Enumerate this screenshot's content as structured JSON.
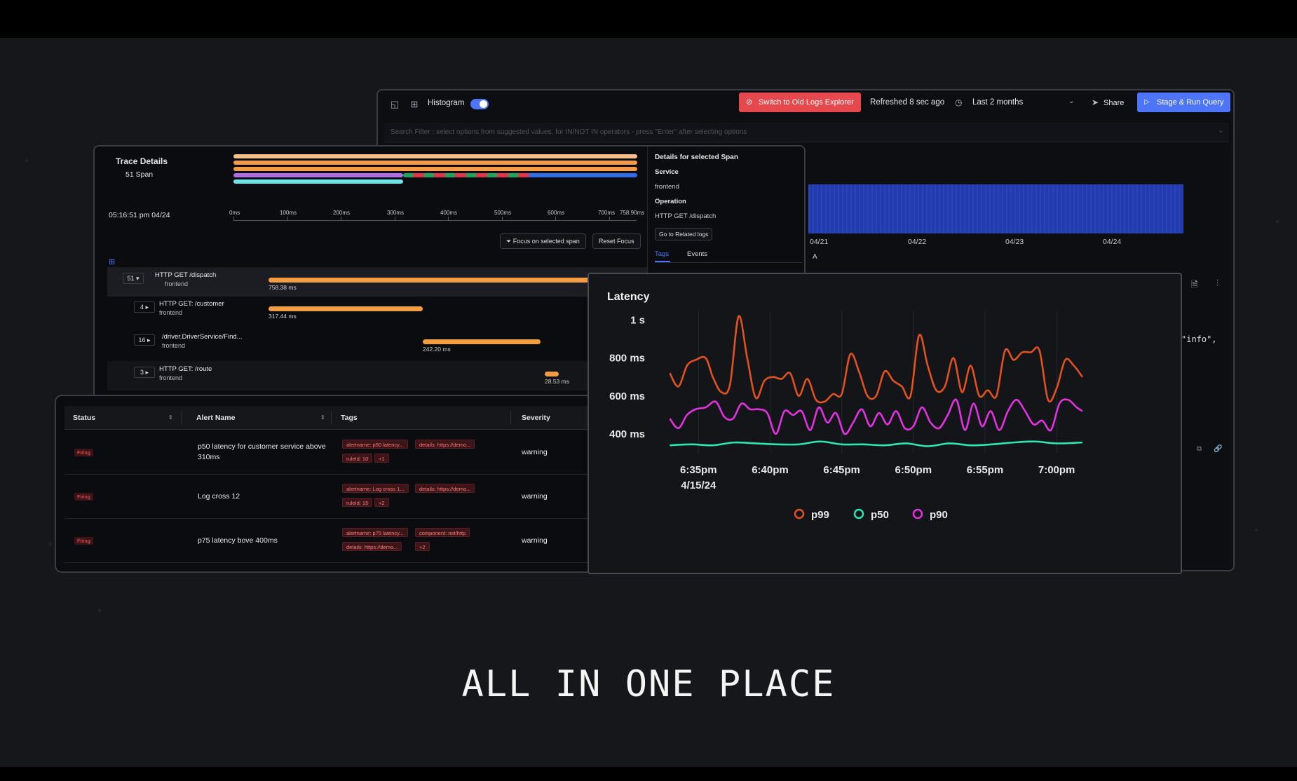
{
  "logs_explorer": {
    "histogram_label": "Histogram",
    "histogram_enabled": true,
    "switch_button": "Switch to Old Logs Explorer",
    "refreshed": "Refreshed 8 sec ago",
    "time_range": "Last 2 months",
    "share": "Share",
    "run_query": "Stage & Run Query",
    "search_placeholder": "Search Filter : select options from suggested values, for IN/NOT IN operators - press \"Enter\" after selecting options",
    "x_ticks": [
      "04/21",
      "04/22",
      "04/23",
      "04/24"
    ],
    "legend_a": "A",
    "snippet_text": "\"info\","
  },
  "trace_details": {
    "title": "Trace Details",
    "span_count": "51 Span",
    "timestamp": "05:16:51 pm 04/24",
    "ticks": [
      "0ms",
      "100ms",
      "200ms",
      "300ms",
      "400ms",
      "500ms",
      "600ms",
      "700ms",
      "758.90ms"
    ],
    "focus_button": "Focus on selected span",
    "reset_button": "Reset Focus",
    "rows": [
      {
        "count": "51",
        "operation": "HTTP GET /dispatch",
        "service": "frontend",
        "duration": "758.38 ms"
      },
      {
        "count": "4",
        "operation": "HTTP GET: /customer",
        "service": "frontend",
        "duration": "317.44 ms"
      },
      {
        "count": "16",
        "operation": "/driver.DriverService/Find...",
        "service": "frontend",
        "duration": "242.20 ms"
      },
      {
        "count": "3",
        "operation": "HTTP GET: /route",
        "service": "frontend",
        "duration": "28.53 ms"
      }
    ],
    "details": {
      "heading": "Details for selected Span",
      "service_label": "Service",
      "service_value": "frontend",
      "operation_label": "Operation",
      "operation_value": "HTTP GET /dispatch",
      "related_logs_button": "Go to Related logs",
      "tab_tags": "Tags",
      "tab_events": "Events"
    }
  },
  "alerts": {
    "columns": [
      "Status",
      "Alert Name",
      "Tags",
      "Severity"
    ],
    "rows": [
      {
        "status": "Firing",
        "name": "p50 latency for customer service above 310ms",
        "tags": [
          "alertname: p50 latency...",
          "details: https://demo...",
          "ruleId: 10",
          "+1"
        ],
        "severity": "warning"
      },
      {
        "status": "Firing",
        "name": "Log cross 12",
        "tags": [
          "alertname: Log cross 1...",
          "details: https://demo...",
          "ruleId: 15",
          "+2"
        ],
        "severity": "warning"
      },
      {
        "status": "Firing",
        "name": "p75 latency bove 400ms",
        "tags": [
          "alertname: p75 latency...",
          "component: net/http",
          "details: https://demo...",
          "+2"
        ],
        "severity": "warning"
      }
    ]
  },
  "chart_data": {
    "type": "line",
    "title": "Latency",
    "y_ticks": [
      "1 s",
      "800 ms",
      "600 ms",
      "400 ms"
    ],
    "y_tick_values": [
      1000,
      800,
      600,
      400
    ],
    "x_ticks": [
      "6:35pm",
      "6:40pm",
      "6:45pm",
      "6:50pm",
      "6:55pm",
      "7:00pm"
    ],
    "x_tick_values": [
      2,
      7,
      12,
      17,
      22,
      27
    ],
    "x_date_label": "4/15/24",
    "ylim": [
      300,
      1050
    ],
    "xlim": [
      -1,
      29
    ],
    "legend_position": "bottom",
    "series": [
      {
        "name": "p99",
        "color": "#e0521f",
        "x": [
          0,
          0.6,
          1.2,
          1.8,
          2.5,
          3,
          3.6,
          4.2,
          4.8,
          5.4,
          6,
          6.6,
          7.2,
          7.8,
          8.4,
          9,
          9.6,
          10.2,
          10.8,
          11.4,
          12,
          12.6,
          13.2,
          13.8,
          14.4,
          15,
          15.6,
          16.2,
          16.8,
          17.4,
          18,
          18.6,
          19.2,
          19.8,
          20.4,
          21,
          21.6,
          22.2,
          22.8,
          23.4,
          24,
          24.6,
          25.2,
          25.8,
          26.4,
          27,
          27.6,
          28.2,
          28.8
        ],
        "y": [
          720,
          650,
          760,
          790,
          800,
          700,
          620,
          660,
          1020,
          800,
          590,
          680,
          700,
          690,
          720,
          600,
          690,
          580,
          570,
          610,
          610,
          820,
          730,
          600,
          600,
          730,
          680,
          650,
          600,
          920,
          760,
          630,
          650,
          800,
          620,
          760,
          600,
          630,
          600,
          840,
          790,
          830,
          830,
          840,
          580,
          640,
          790,
          760,
          700
        ]
      },
      {
        "name": "p50",
        "color": "#2ee6b2",
        "x": [
          0,
          1.5,
          3,
          4.5,
          6,
          7.5,
          9,
          10.5,
          12,
          13.5,
          15,
          16.5,
          18,
          19.5,
          21,
          22.5,
          24,
          25.5,
          27,
          28.8
        ],
        "y": [
          340,
          345,
          340,
          355,
          350,
          345,
          345,
          360,
          345,
          345,
          340,
          350,
          335,
          350,
          340,
          345,
          355,
          360,
          350,
          355
        ]
      },
      {
        "name": "p90",
        "color": "#e233e0",
        "x": [
          0,
          0.6,
          1.2,
          1.8,
          2.5,
          3.2,
          3.8,
          4.4,
          5,
          5.6,
          6.2,
          6.8,
          7.4,
          8,
          8.6,
          9.2,
          9.8,
          10.4,
          11,
          11.6,
          12.2,
          12.8,
          13.4,
          14,
          14.6,
          15.2,
          15.8,
          16.4,
          17,
          17.6,
          18.2,
          18.8,
          19.4,
          20,
          20.6,
          21.2,
          21.8,
          22.4,
          23,
          23.6,
          24.2,
          24.8,
          25.4,
          26,
          26.6,
          27.2,
          27.8,
          28.4,
          28.8
        ],
        "y": [
          480,
          430,
          500,
          530,
          540,
          570,
          490,
          480,
          560,
          530,
          530,
          510,
          400,
          520,
          500,
          520,
          420,
          540,
          460,
          510,
          400,
          460,
          530,
          440,
          510,
          450,
          520,
          430,
          440,
          540,
          460,
          430,
          500,
          580,
          420,
          560,
          440,
          520,
          420,
          520,
          580,
          520,
          450,
          470,
          420,
          560,
          580,
          540,
          520
        ]
      }
    ]
  },
  "tagline": "ALL IN ONE PLACE"
}
